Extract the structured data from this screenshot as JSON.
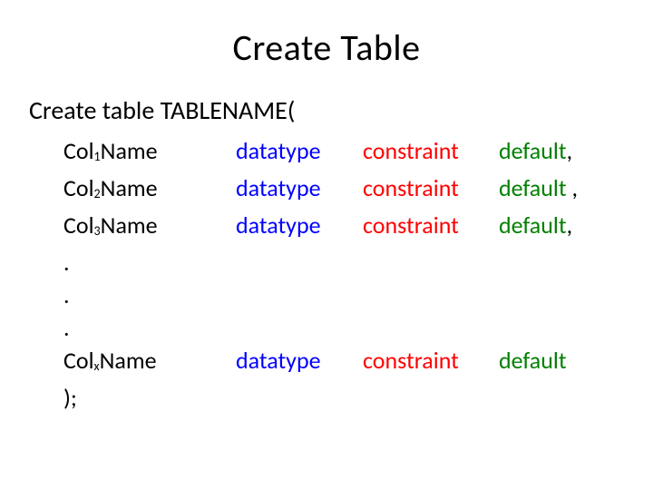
{
  "title": "Create Table",
  "statement": "Create table TABLENAME(",
  "rows": {
    "r1": {
      "pre": "Col",
      "sub": "1",
      "post": "Name",
      "dtype": "datatype",
      "constr": "constraint",
      "dflt": "default",
      "comma": ","
    },
    "r2": {
      "pre": "Col",
      "sub": "2",
      "post": "Name",
      "dtype": "datatype",
      "constr": "constraint",
      "dflt": "default ",
      "comma": ","
    },
    "r3": {
      "pre": "Col",
      "sub": "3",
      "post": "Name",
      "dtype": "datatype",
      "constr": "constraint",
      "dflt": "default",
      "comma": ","
    },
    "dot1": ".",
    "dot2": ".",
    "dot3": ".",
    "rx": {
      "pre": "Col",
      "sub": "x",
      "post": "Name",
      "dtype": "datatype",
      "constr": "constraint",
      "dflt": "default",
      "comma": ""
    },
    "close": ");"
  }
}
